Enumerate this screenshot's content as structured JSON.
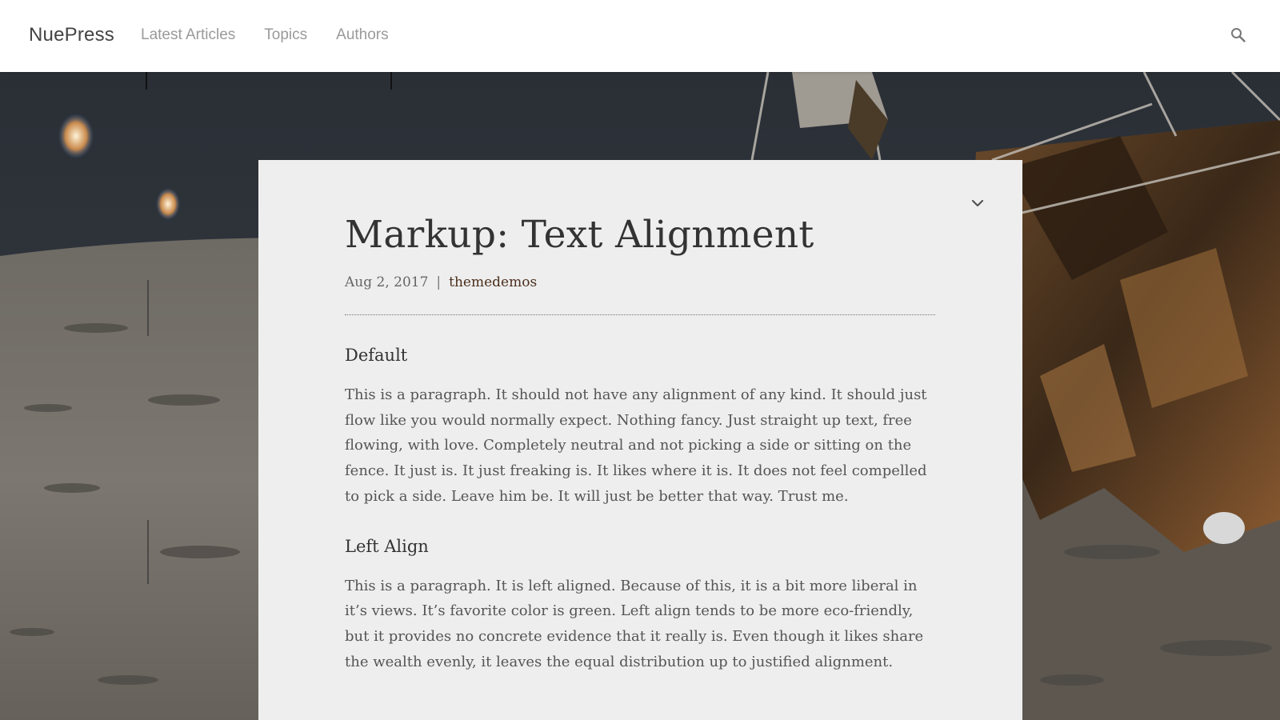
{
  "header": {
    "brand": "NuePress",
    "nav": [
      {
        "label": "Latest Articles"
      },
      {
        "label": "Topics"
      },
      {
        "label": "Authors"
      }
    ],
    "search_icon": "search-icon"
  },
  "article": {
    "title": "Markup: Text Alignment",
    "date": "Aug 2, 2017",
    "separator": "|",
    "author": "themedemos",
    "sections": [
      {
        "heading": "Default",
        "body": "This is a paragraph. It should not have any alignment of any kind. It should just flow like you would normally expect. Nothing fancy. Just straight up text, free flowing, with love. Completely neutral and not picking a side or sitting on the fence. It just is. It just freaking is. It likes where it is. It does not feel compelled to pick a side. Leave him be. It will just be better that way. Trust me."
      },
      {
        "heading": "Left Align",
        "body": "This is a paragraph. It is left aligned. Because of this, it is a bit more liberal in it’s views. It’s favorite color is green. Left align tends to be more eco-friendly, but it provides no concrete evidence that it really is. Even though it likes share the wealth evenly, it leaves the equal distribution up to justified alignment."
      }
    ],
    "collapse_icon": "chevron-down-icon"
  },
  "colors": {
    "header_bg": "#ffffff",
    "card_bg": "#eeeeee",
    "author_link": "#4a2e1c"
  }
}
